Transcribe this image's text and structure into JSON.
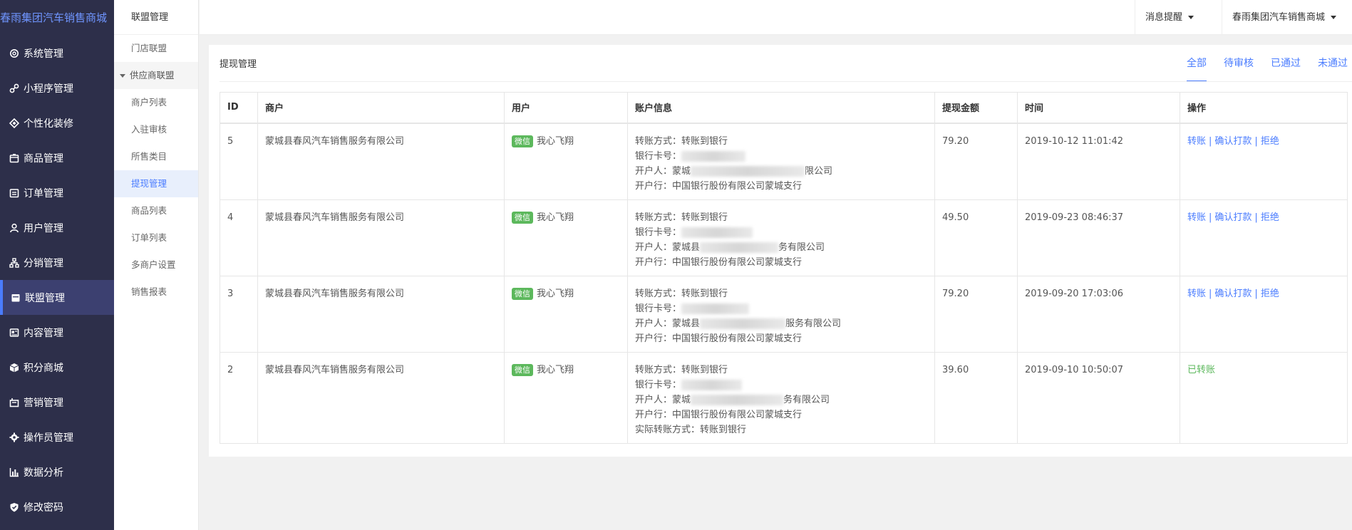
{
  "brand": "春雨集团汽车销售商城",
  "sidebar": {
    "items": [
      {
        "label": "系统管理",
        "icon": "gear-icon"
      },
      {
        "label": "小程序管理",
        "icon": "link-icon"
      },
      {
        "label": "个性化装修",
        "icon": "diamond-icon"
      },
      {
        "label": "商品管理",
        "icon": "box-icon"
      },
      {
        "label": "订单管理",
        "icon": "calendar-icon"
      },
      {
        "label": "用户管理",
        "icon": "user-icon"
      },
      {
        "label": "分销管理",
        "icon": "sitemap-icon"
      },
      {
        "label": "联盟管理",
        "icon": "store-icon"
      },
      {
        "label": "内容管理",
        "icon": "content-icon"
      },
      {
        "label": "积分商城",
        "icon": "cube-icon"
      },
      {
        "label": "营销管理",
        "icon": "marketing-icon"
      },
      {
        "label": "操作员管理",
        "icon": "cog-icon"
      },
      {
        "label": "数据分析",
        "icon": "bar-chart-icon"
      },
      {
        "label": "修改密码",
        "icon": "shield-icon"
      }
    ],
    "active": 7
  },
  "subnav": {
    "title": "联盟管理",
    "store_alliance": "门店联盟",
    "supplier_group": "供应商联盟",
    "items": [
      "商户列表",
      "入驻审核",
      "所售类目",
      "提现管理",
      "商品列表",
      "订单列表",
      "多商户设置",
      "销售报表"
    ]
  },
  "topbar": {
    "messages": "消息提醒",
    "account": "春雨集团汽车销售商城"
  },
  "panel": {
    "title": "提现管理",
    "tabs": [
      "全部",
      "待审核",
      "已通过",
      "未通过"
    ]
  },
  "table": {
    "headers": [
      "ID",
      "商户",
      "用户",
      "账户信息",
      "提现金额",
      "时间",
      "操作"
    ],
    "rows": [
      {
        "id": "5",
        "merchant": "蒙城县春风汽车销售服务有限公司",
        "badge": "微信",
        "user": "我心飞翔",
        "method_label": "转账方式：",
        "method": "转账到银行",
        "card_label": "银行卡号：",
        "holder_label": "开户人：",
        "holder_start": "蒙城",
        "holder_end": "限公司",
        "bank_label": "开户行：",
        "bank": "中国银行股份有限公司蒙城支行",
        "amount": "79.20",
        "time": "2019-10-12 11:01:42",
        "ops": [
          "转账",
          "确认打款",
          "拒绝"
        ],
        "sep": "|"
      },
      {
        "id": "4",
        "merchant": "蒙城县春风汽车销售服务有限公司",
        "badge": "微信",
        "user": "我心飞翔",
        "method_label": "转账方式：",
        "method": "转账到银行",
        "card_label": "银行卡号：",
        "holder_label": "开户人：",
        "holder_start": "蒙城县",
        "holder_end": "务有限公司",
        "bank_label": "开户行：",
        "bank": "中国银行股份有限公司蒙城支行",
        "amount": "49.50",
        "time": "2019-09-23 08:46:37",
        "ops": [
          "转账",
          "确认打款",
          "拒绝"
        ],
        "sep": "|"
      },
      {
        "id": "3",
        "merchant": "蒙城县春风汽车销售服务有限公司",
        "badge": "微信",
        "user": "我心飞翔",
        "method_label": "转账方式：",
        "method": "转账到银行",
        "card_label": "银行卡号：",
        "holder_label": "开户人：",
        "holder_start": "蒙城县",
        "holder_end": "服务有限公司",
        "bank_label": "开户行：",
        "bank": "中国银行股份有限公司蒙城支行",
        "amount": "79.20",
        "time": "2019-09-20 17:03:06",
        "ops": [
          "转账",
          "确认打款",
          "拒绝"
        ],
        "sep": "|"
      },
      {
        "id": "2",
        "merchant": "蒙城县春风汽车销售服务有限公司",
        "badge": "微信",
        "user": "我心飞翔",
        "method_label": "转账方式：",
        "method": "转账到银行",
        "card_label": "银行卡号：",
        "holder_label": "开户人：",
        "holder_start": "蒙城",
        "holder_end": "务有限公司",
        "bank_label": "开户行：",
        "bank": "中国银行股份有限公司蒙城支行",
        "actual_label": "实际转账方式：",
        "actual": "转账到银行",
        "amount": "39.60",
        "time": "2019-09-10 10:50:07",
        "status": "已转账"
      }
    ]
  },
  "colors": {
    "sidebar_bg": "#2d2f4a",
    "accent": "#4a7cff",
    "brand": "#6f95ff",
    "success": "#5cb85c"
  }
}
